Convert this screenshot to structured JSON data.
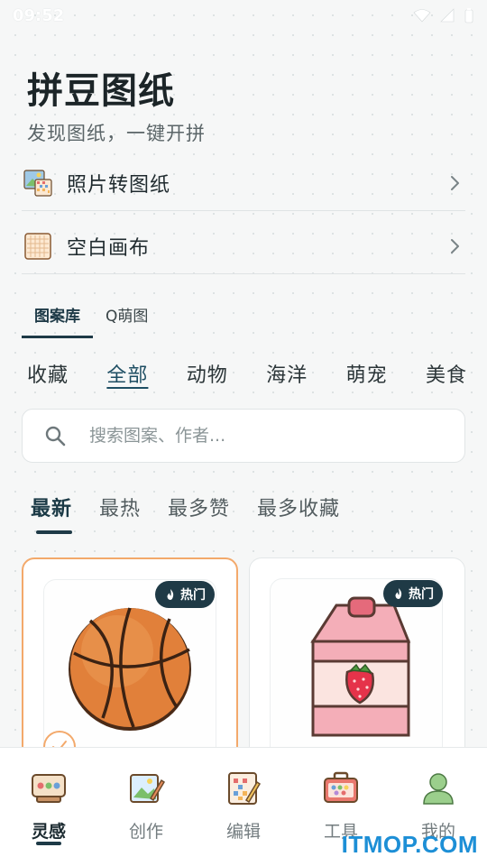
{
  "status_bar": {
    "time": "09:52"
  },
  "header": {
    "title": "拼豆图纸",
    "subtitle": "发现图纸，一键开拼"
  },
  "menu": [
    {
      "label": "照片转图纸",
      "icon": "photo-to-pattern-icon"
    },
    {
      "label": "空白画布",
      "icon": "blank-canvas-icon"
    }
  ],
  "library_tabs": [
    {
      "label": "图案库",
      "active": true
    },
    {
      "label": "Q萌图",
      "active": false
    }
  ],
  "categories": [
    "收藏",
    "全部",
    "动物",
    "海洋",
    "萌宠",
    "美食"
  ],
  "active_category": "全部",
  "search": {
    "placeholder": "搜索图案、作者..."
  },
  "sort_tabs": [
    "最新",
    "最热",
    "最多赞",
    "最多收藏"
  ],
  "active_sort": "最新",
  "cards": [
    {
      "badge": "热门",
      "art": "basketball-icon",
      "selected": true
    },
    {
      "badge": "热门",
      "art": "strawberry-milk-carton-icon",
      "selected": false
    }
  ],
  "bottom_nav": [
    {
      "label": "灵感",
      "icon": "inspiration-icon",
      "active": true
    },
    {
      "label": "创作",
      "icon": "create-icon",
      "active": false
    },
    {
      "label": "编辑",
      "icon": "edit-icon",
      "active": false
    },
    {
      "label": "工具",
      "icon": "toolbox-icon",
      "active": false
    },
    {
      "label": "我的",
      "icon": "profile-icon",
      "active": false
    }
  ],
  "watermark": "ITMOP.COM",
  "colors": {
    "accent": "#1e3a47",
    "highlight": "#f3a96b",
    "watermark": "#1d8fd6"
  }
}
